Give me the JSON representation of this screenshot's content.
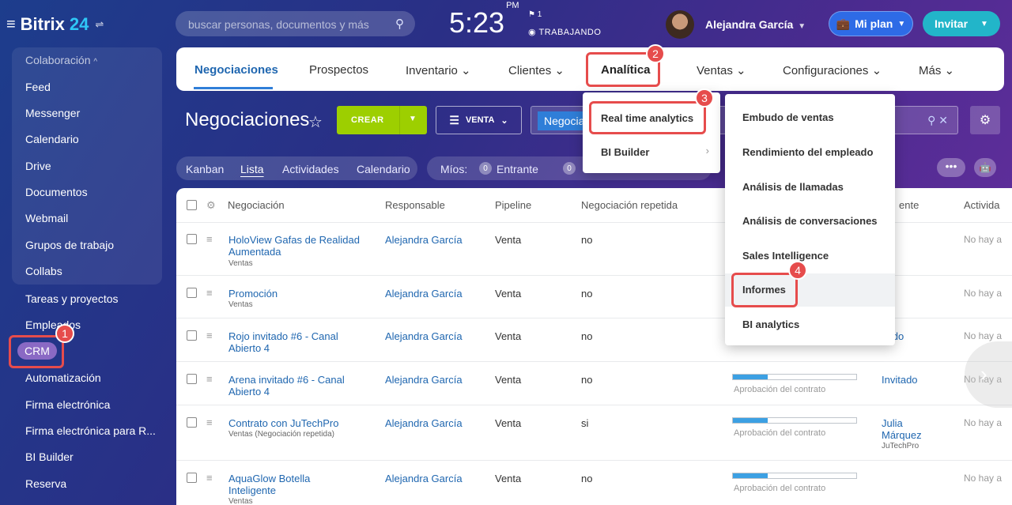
{
  "header": {
    "brand": "Bitrix",
    "brand_num": "24",
    "search_placeholder": "buscar personas, documentos y más",
    "time": "5:23",
    "ampm": "PM",
    "flag_count": "1",
    "status": "TRABAJANDO",
    "user_name": "Alejandra García",
    "plan_label": "Mi plan",
    "invite_label": "Invitar"
  },
  "sidebar": {
    "group_title": "Colaboración",
    "items": [
      "Feed",
      "Messenger",
      "Calendario",
      "Drive",
      "Documentos",
      "Webmail",
      "Grupos de trabajo",
      "Collabs"
    ],
    "items2": [
      "Tareas y proyectos",
      "Empleados",
      "CRM",
      "Automatización",
      "Firma electrónica",
      "Firma electrónica para R...",
      "BI Builder",
      "Reserva"
    ]
  },
  "tabs": [
    "Negociaciones",
    "Prospectos",
    "Inventario",
    "Clientes",
    "Analítica",
    "Ventas",
    "Configuraciones",
    "Más"
  ],
  "toolbar": {
    "title": "Negociaciones",
    "create_label": "CREAR",
    "filter_label": "VENTA",
    "search_chip": "Negociaciones"
  },
  "views": [
    "Kanban",
    "Lista",
    "Actividades",
    "Calendario"
  ],
  "mine": {
    "label": "Míos:",
    "count_incoming": "0",
    "incoming_label": "Entrante",
    "count2": "0"
  },
  "table": {
    "columns": [
      "Negociación",
      "Responsable",
      "Pipeline",
      "Negociación repetida",
      "ente",
      "Activida"
    ],
    "rows": [
      {
        "name1": "HoloView Gafas de Realidad",
        "name2": "Aumentada",
        "sub": "Ventas",
        "resp": "Alejandra García",
        "pipe": "Venta",
        "rep": "no",
        "contact": "",
        "contact2": "",
        "act": "No hay a"
      },
      {
        "name1": "Promoción",
        "name2": "",
        "sub": "Ventas",
        "resp": "Alejandra García",
        "pipe": "Venta",
        "rep": "no",
        "contact": "",
        "contact2": "",
        "act": "No hay a"
      },
      {
        "name1": "Rojo invitado #6 - Canal",
        "name2": "Abierto 4",
        "sub": "",
        "resp": "Alejandra García",
        "pipe": "Venta",
        "rep": "no",
        "contact": "itado",
        "contact2": "",
        "act": "No hay a"
      },
      {
        "name1": "Arena invitado #6 - Canal",
        "name2": "Abierto 4",
        "sub": "",
        "resp": "Alejandra García",
        "pipe": "Venta",
        "rep": "no",
        "contact": "Invitado",
        "contact2": "",
        "act": "No hay a"
      },
      {
        "name1": "Contrato con JuTechPro",
        "name2": "",
        "sub": "Ventas (Negociación repetida)",
        "resp": "Alejandra García",
        "pipe": "Venta",
        "rep": "si",
        "contact": "Julia",
        "contact2": "Márquez",
        "act": "No hay a"
      },
      {
        "name1": "AquaGlow Botella",
        "name2": "Inteligente",
        "sub": "Ventas",
        "resp": "Alejandra García",
        "pipe": "Venta",
        "rep": "no",
        "contact": "",
        "contact2": "",
        "act": "No hay a"
      }
    ],
    "stage_label": "Aprobación del contrato",
    "contact_company": "JuTechPro",
    "progress_fraction": 0.28
  },
  "analytics_menu": {
    "items": [
      "Real time analytics",
      "BI Builder"
    ]
  },
  "analytics_submenu": {
    "items": [
      "Embudo de ventas",
      "Rendimiento del empleado",
      "Análisis de llamadas",
      "Análisis de conversaciones",
      "Sales Intelligence",
      "Informes",
      "BI analytics"
    ]
  },
  "badges": [
    "1",
    "2",
    "3",
    "4"
  ]
}
